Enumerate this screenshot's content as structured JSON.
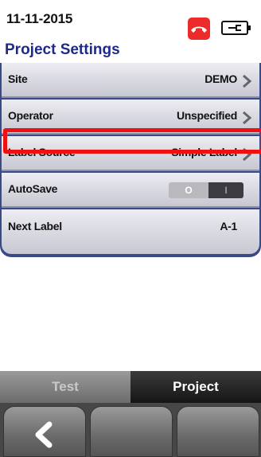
{
  "status_bar": {
    "date": "11-11-2015",
    "phone_icon": "phone-hangup-icon",
    "battery_icon": "battery-icon"
  },
  "page": {
    "title": "Project Settings"
  },
  "settings": [
    {
      "label": "Site",
      "value": "DEMO"
    },
    {
      "label": "Operator",
      "value": "Unspecified"
    },
    {
      "label": "Label Source",
      "value": "Simple Label"
    },
    {
      "label": "AutoSave",
      "toggle_off": "O",
      "toggle_on": "I",
      "state": "on"
    },
    {
      "label": "Next Label",
      "value": "A-1"
    }
  ],
  "tabs": [
    {
      "label": "Test"
    },
    {
      "label": "Project",
      "active": true
    }
  ],
  "softkeys": [
    {
      "icon": "back-chevron-icon"
    },
    {
      "icon": ""
    },
    {
      "icon": ""
    }
  ],
  "colors": {
    "title": "#1d2a8a",
    "highlight": "#ee1111",
    "phone": "#ee2b2b"
  }
}
